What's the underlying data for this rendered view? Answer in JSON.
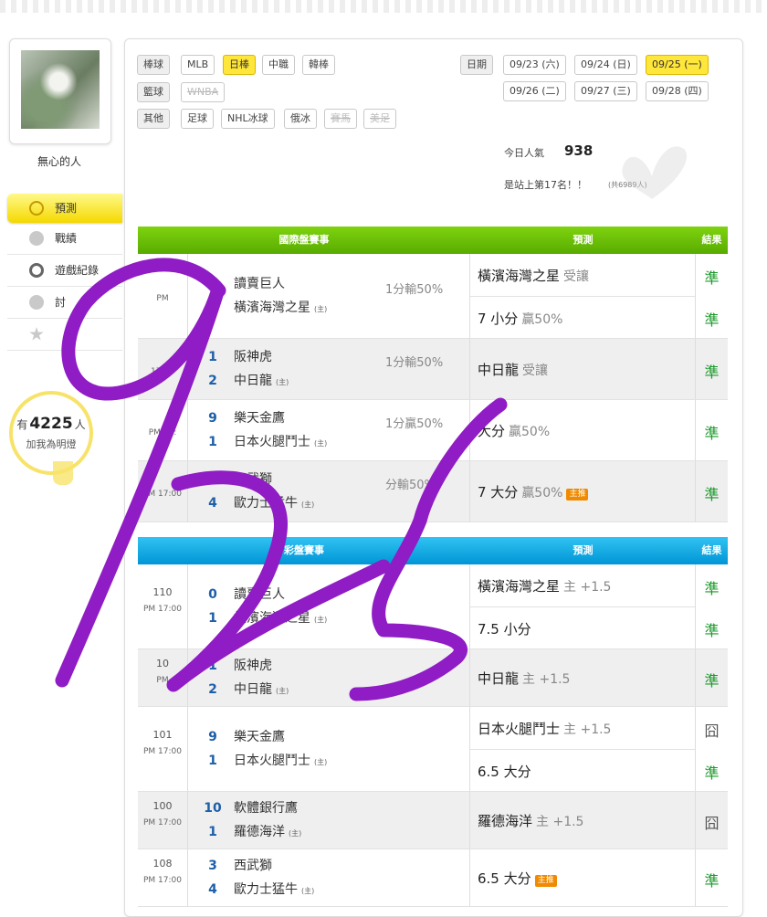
{
  "user": {
    "name": "無心的人"
  },
  "sidebar": {
    "items": [
      {
        "label": "預測",
        "icon": "target-icon",
        "active": true
      },
      {
        "label": "戰績",
        "icon": "chart-icon"
      },
      {
        "label": "遊戲紀錄",
        "icon": "circle-icon"
      },
      {
        "label": "討",
        "icon": "search-icon"
      },
      {
        "label": "",
        "icon": "star-icon"
      }
    ]
  },
  "light": {
    "prefix": "有",
    "count": "4225",
    "suffix": "人",
    "caption": "加我為明燈"
  },
  "filters": {
    "baseball": {
      "label": "棒球",
      "items": [
        {
          "label": "MLB"
        },
        {
          "label": "日棒",
          "selected": true
        },
        {
          "label": "中職"
        },
        {
          "label": "韓棒"
        }
      ]
    },
    "basketball": {
      "label": "籃球",
      "items": [
        {
          "label": "WNBA",
          "disabled": true
        }
      ]
    },
    "other": {
      "label": "其他",
      "items": [
        {
          "label": "足球"
        },
        {
          "label": "NHL冰球"
        },
        {
          "label": "俄冰"
        },
        {
          "label": "賽馬",
          "disabled": true
        },
        {
          "label": "美足",
          "disabled": true
        }
      ]
    },
    "date_label": "日期",
    "dates": [
      {
        "label": "09/23 (六)"
      },
      {
        "label": "09/24 (日)"
      },
      {
        "label": "09/25 (一)",
        "selected": true
      },
      {
        "label": "09/26 (二)"
      },
      {
        "label": "09/27 (三)"
      },
      {
        "label": "09/28 (四)"
      }
    ]
  },
  "stats": {
    "today_label": "今日人氣",
    "today_value": "938",
    "rank_text": "是站上第17名！！",
    "rank_total": "(共6989人)"
  },
  "intl": {
    "head": {
      "matches": "國際盤賽事",
      "prediction": "預測",
      "result": "結果"
    },
    "games": [
      {
        "no": "",
        "time": "PM",
        "gray": false,
        "teams": [
          {
            "score": "0",
            "name": "讀賣巨人",
            "home": false
          },
          {
            "score": "1",
            "name": "橫濱海灣之星",
            "home": true
          }
        ],
        "odds": "1分輸50%",
        "preds": [
          {
            "text": "橫濱海灣之星",
            "sub": "受讓",
            "result": "準"
          },
          {
            "text": "7 小分",
            "sub": "贏50%",
            "result": "準"
          }
        ]
      },
      {
        "no": "",
        "time": "17:00",
        "gray": true,
        "teams": [
          {
            "score": "1",
            "name": "阪神虎",
            "home": false
          },
          {
            "score": "2",
            "name": "中日龍",
            "home": true
          }
        ],
        "odds": "1分輸50%",
        "preds": [
          {
            "text": "中日龍",
            "sub": "受讓",
            "result": "準"
          }
        ]
      },
      {
        "no": "",
        "time": "PM 17:",
        "gray": false,
        "teams": [
          {
            "score": "9",
            "name": "樂天金鷹",
            "home": false
          },
          {
            "score": "1",
            "name": "日本火腿鬥士",
            "home": true
          }
        ],
        "odds": "1分贏50%",
        "preds": [
          {
            "text": "大分",
            "sub": "贏50%",
            "result": "準"
          }
        ]
      },
      {
        "no": "",
        "time": "PM 17:00",
        "gray": true,
        "teams": [
          {
            "score": "3",
            "name": "西武獅",
            "home": false
          },
          {
            "score": "4",
            "name": "歐力士猛牛",
            "home": true
          }
        ],
        "odds": "分輸50%",
        "preds": [
          {
            "text": "7 大分",
            "sub": "贏50%",
            "star": "主推",
            "result": "準"
          }
        ]
      }
    ]
  },
  "lottery": {
    "head": {
      "matches": "彩盤賽事",
      "prediction": "預測",
      "result": "結果"
    },
    "games": [
      {
        "no": "110",
        "time": "PM 17:00",
        "gray": false,
        "teams": [
          {
            "score": "0",
            "name": "讀賣巨人",
            "home": false
          },
          {
            "score": "1",
            "name": "橫濱海灣之星",
            "home": true
          }
        ],
        "preds": [
          {
            "text": "橫濱海灣之星",
            "sub": "主 +1.5",
            "result": "準"
          },
          {
            "text": "7.5 小分",
            "sub": "",
            "result": "準"
          }
        ]
      },
      {
        "no": "10",
        "time": "PM",
        "gray": true,
        "teams": [
          {
            "score": "1",
            "name": "阪神虎",
            "home": false
          },
          {
            "score": "2",
            "name": "中日龍",
            "home": true
          }
        ],
        "preds": [
          {
            "text": "中日龍",
            "sub": "主 +1.5",
            "result": "準"
          }
        ]
      },
      {
        "no": "101",
        "time": "PM 17:00",
        "gray": false,
        "teams": [
          {
            "score": "9",
            "name": "樂天金鷹",
            "home": false
          },
          {
            "score": "1",
            "name": "日本火腿鬥士",
            "home": true
          }
        ],
        "preds": [
          {
            "text": "日本火腿鬥士",
            "sub": "主 +1.5",
            "result": "囧"
          },
          {
            "text": "6.5 大分",
            "sub": "",
            "result": "準"
          }
        ]
      },
      {
        "no": "100",
        "time": "PM 17:00",
        "gray": true,
        "teams": [
          {
            "score": "10",
            "name": "軟體銀行鷹",
            "home": false
          },
          {
            "score": "1",
            "name": "羅德海洋",
            "home": true
          }
        ],
        "preds": [
          {
            "text": "羅德海洋",
            "sub": "主 +1.5",
            "result": "囧"
          }
        ]
      },
      {
        "no": "108",
        "time": "PM 17:00",
        "gray": false,
        "teams": [
          {
            "score": "3",
            "name": "西武獅",
            "home": false
          },
          {
            "score": "4",
            "name": "歐力士猛牛",
            "home": true
          }
        ],
        "preds": [
          {
            "text": "6.5 大分",
            "sub": "",
            "star": "主推",
            "result": "準"
          }
        ]
      }
    ]
  },
  "colors": {
    "accent_yellow": "#ffe63a",
    "header_green": "#6cc20a",
    "header_blue": "#1aaee8",
    "ok_green": "#1a9a2a",
    "scribble": "#8f1cc4"
  }
}
